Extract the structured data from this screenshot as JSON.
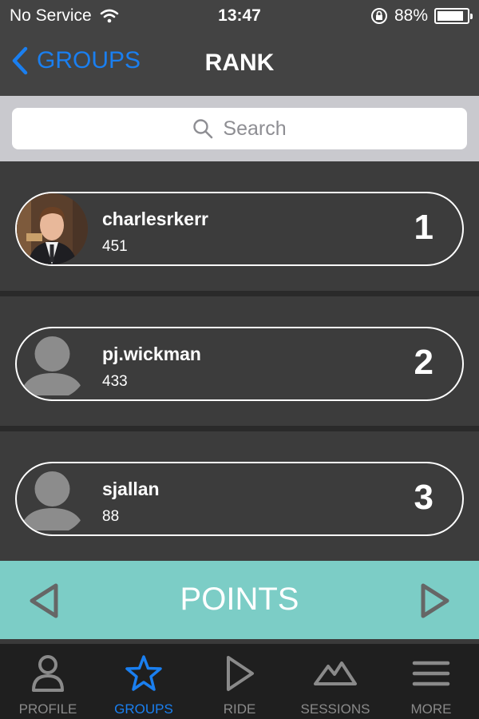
{
  "status_bar": {
    "carrier": "No Service",
    "time": "13:47",
    "battery_percent": "88%",
    "battery_level": 0.88
  },
  "nav": {
    "back_label": "GROUPS",
    "title": "RANK"
  },
  "search": {
    "placeholder": "Search"
  },
  "rankings": [
    {
      "username": "charlesrkerr",
      "points": "451",
      "rank": "1",
      "avatar": "photo"
    },
    {
      "username": "pj.wickman",
      "points": "433",
      "rank": "2",
      "avatar": "default-avatar-icon"
    },
    {
      "username": "sjallan",
      "points": "88",
      "rank": "3",
      "avatar": "default-avatar-icon"
    }
  ],
  "metric": {
    "label": "POINTS"
  },
  "tabs": [
    {
      "label": "PROFILE",
      "icon": "person-icon",
      "active": false
    },
    {
      "label": "GROUPS",
      "icon": "star-icon",
      "active": true
    },
    {
      "label": "RIDE",
      "icon": "play-icon",
      "active": false
    },
    {
      "label": "SESSIONS",
      "icon": "mountain-icon",
      "active": false
    },
    {
      "label": "MORE",
      "icon": "menu-icon",
      "active": false
    }
  ],
  "colors": {
    "accent": "#1a7ff0",
    "points_bar": "#7ccdc6",
    "bar_background": "#434343"
  }
}
